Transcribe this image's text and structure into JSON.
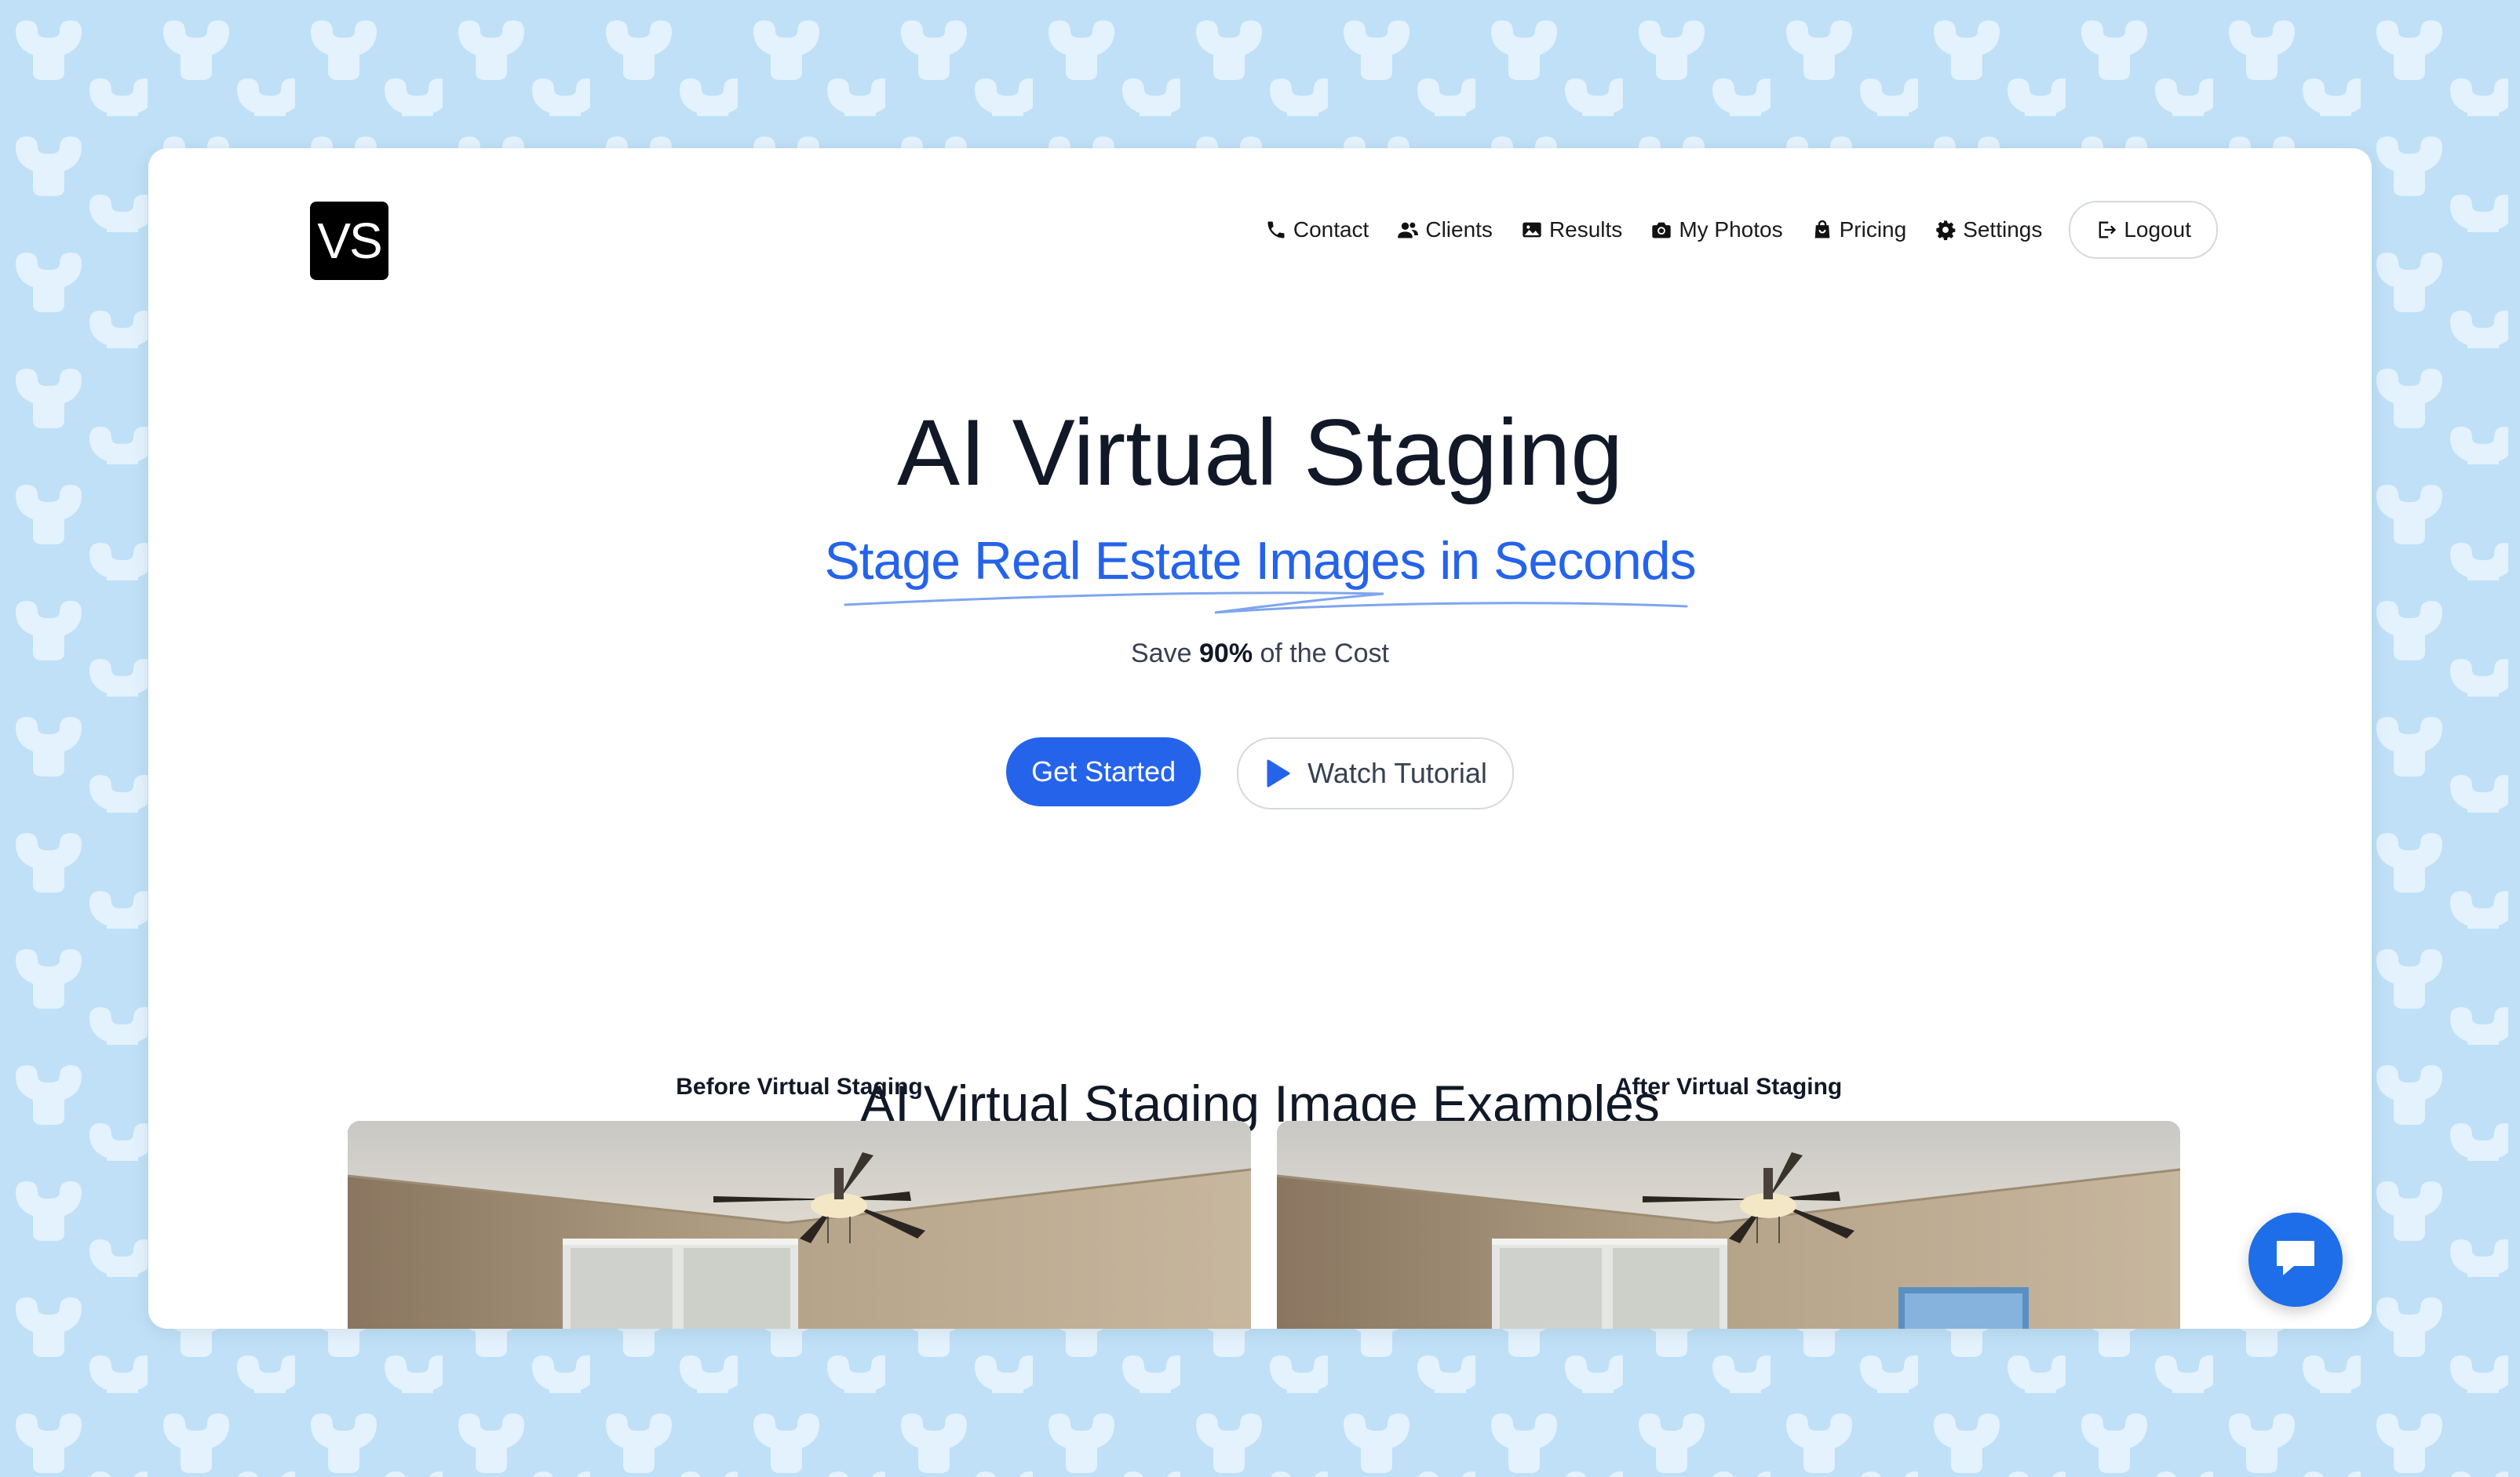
{
  "brand": {
    "logo_text": "VS"
  },
  "nav": {
    "items": [
      {
        "label": "Contact",
        "icon": "phone-icon"
      },
      {
        "label": "Clients",
        "icon": "users-icon"
      },
      {
        "label": "Results",
        "icon": "image-icon"
      },
      {
        "label": "My Photos",
        "icon": "camera-icon"
      },
      {
        "label": "Pricing",
        "icon": "shopping-bag-icon"
      },
      {
        "label": "Settings",
        "icon": "gear-icon"
      }
    ],
    "logout_label": "Logout",
    "logout_icon": "logout-icon"
  },
  "hero": {
    "title": "AI Virtual Staging",
    "subtitle": "Stage Real Estate Images in Seconds",
    "tagline_prefix": "Save ",
    "tagline_bold": "90%",
    "tagline_suffix": " of the Cost",
    "primary_cta": "Get Started",
    "secondary_cta": "Watch Tutorial",
    "secondary_cta_icon": "play-icon"
  },
  "examples": {
    "heading": "AI Virtual Staging Image Examples",
    "before_label": "Before Virtual Staging",
    "after_label": "After Virtual Staging"
  },
  "chat": {
    "icon": "chat-bubble-icon"
  },
  "colors": {
    "accent": "#2563eb",
    "background_pattern": "#bfe0f7",
    "pattern_shape": "#e3f2fc",
    "chat_button": "#1d6ee8",
    "text_dark": "#111827"
  }
}
